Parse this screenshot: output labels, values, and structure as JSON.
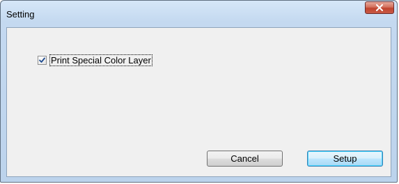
{
  "window": {
    "title": "Setting"
  },
  "close_button": {
    "icon": "close-icon",
    "color": "#c8432d"
  },
  "options": {
    "print_special_color_layer": {
      "label": "Print Special Color Layer",
      "checked": true
    }
  },
  "buttons": {
    "cancel_label": "Cancel",
    "setup_label": "Setup"
  },
  "colors": {
    "titlebar": "#c9dcf1",
    "client_bg": "#f0f0f0",
    "default_button": "#bee6fd",
    "checkmark": "#1e4b8f"
  }
}
